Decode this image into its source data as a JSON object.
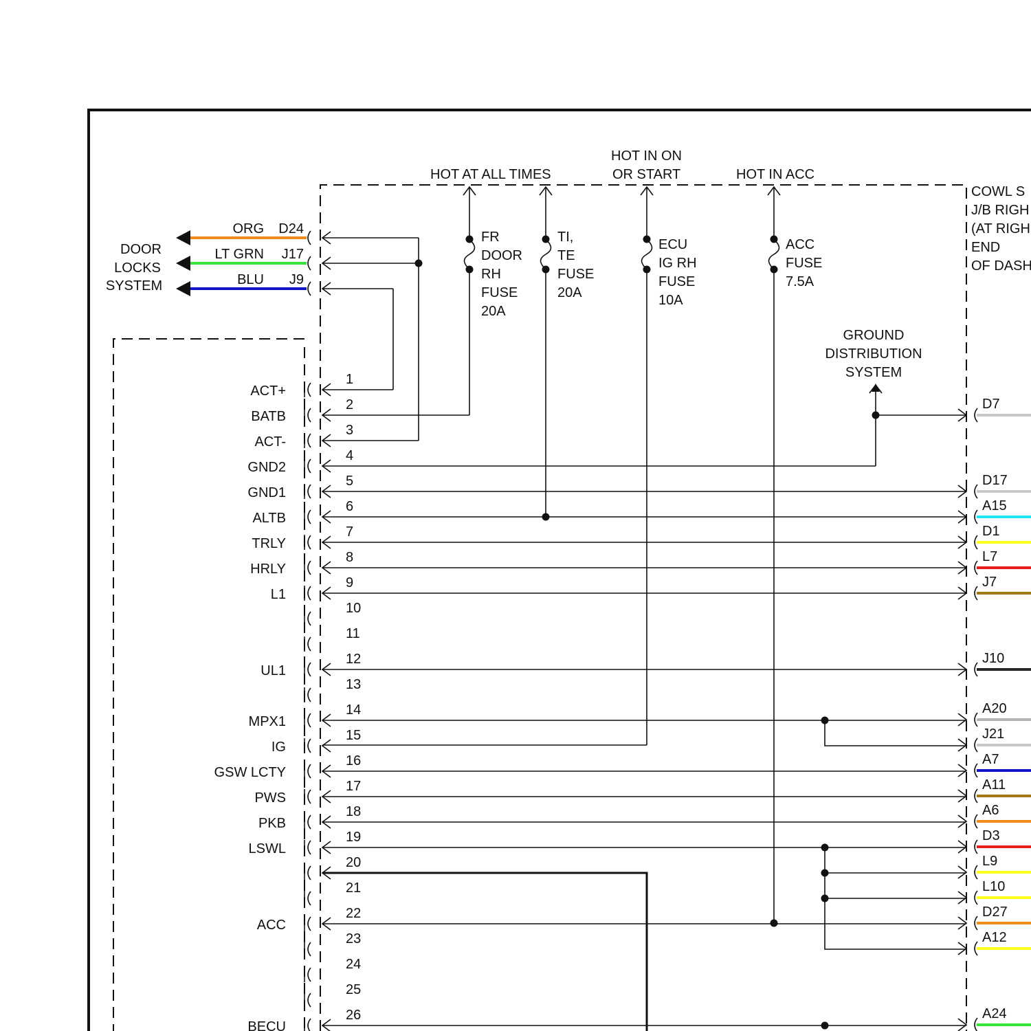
{
  "headers": {
    "hot_all_times": "HOT AT ALL TIMES",
    "hot_on_start_1": "HOT IN ON",
    "hot_on_start_2": "OR START",
    "hot_acc": "HOT IN ACC"
  },
  "fuses": [
    {
      "id": "fr-door",
      "lines": [
        "FR",
        "DOOR",
        "RH",
        "FUSE",
        "20A"
      ]
    },
    {
      "id": "ti-te",
      "lines": [
        "TI,",
        "TE",
        "FUSE",
        "20A"
      ]
    },
    {
      "id": "ecu-ig",
      "lines": [
        "ECU",
        "IG RH",
        "FUSE",
        "10A"
      ]
    },
    {
      "id": "acc",
      "lines": [
        "ACC",
        "FUSE",
        "7.5A"
      ]
    }
  ],
  "cowl_box": [
    "COWL S",
    "J/B RIGH",
    "(AT RIGH",
    "END",
    "OF DASH"
  ],
  "ground_system": [
    "GROUND",
    "DISTRIBUTION",
    "SYSTEM"
  ],
  "door_locks": {
    "label": [
      "DOOR",
      "LOCKS",
      "SYSTEM"
    ],
    "wires": [
      {
        "color_name": "ORG",
        "pin": "D24",
        "hex": "#f08a1c"
      },
      {
        "color_name": "LT GRN",
        "pin": "J17",
        "hex": "#39e23a"
      },
      {
        "color_name": "BLU",
        "pin": "J9",
        "hex": "#1414c8"
      }
    ]
  },
  "pins": [
    "1",
    "2",
    "3",
    "4",
    "5",
    "6",
    "7",
    "8",
    "9",
    "10",
    "11",
    "12",
    "13",
    "14",
    "15",
    "16",
    "17",
    "18",
    "19",
    "20",
    "21",
    "22",
    "23",
    "24",
    "25",
    "26"
  ],
  "signals": [
    {
      "pin": 1,
      "label": "ACT+"
    },
    {
      "pin": 2,
      "label": "BATB"
    },
    {
      "pin": 3,
      "label": "ACT-"
    },
    {
      "pin": 4,
      "label": "GND2"
    },
    {
      "pin": 5,
      "label": "GND1"
    },
    {
      "pin": 6,
      "label": "ALTB"
    },
    {
      "pin": 7,
      "label": "TRLY"
    },
    {
      "pin": 8,
      "label": "HRLY"
    },
    {
      "pin": 9,
      "label": "L1"
    },
    {
      "pin": 12,
      "label": "UL1"
    },
    {
      "pin": 14,
      "label": "MPX1"
    },
    {
      "pin": 15,
      "label": "IG"
    },
    {
      "pin": 16,
      "label": "GSW LCTY"
    },
    {
      "pin": 17,
      "label": "PWS"
    },
    {
      "pin": 18,
      "label": "PKB"
    },
    {
      "pin": 19,
      "label": "LSWL"
    },
    {
      "pin": 22,
      "label": "ACC"
    },
    {
      "pin": 26,
      "label": "BECU"
    }
  ],
  "right_connectors": [
    {
      "pin": "D7",
      "hex": "#c8c8c8"
    },
    {
      "pin": "D17",
      "hex": "#c8c8c8"
    },
    {
      "pin": "A15",
      "hex": "#1ee6f0"
    },
    {
      "pin": "D1",
      "hex": "#ffff1e"
    },
    {
      "pin": "L7",
      "hex": "#e61e1e"
    },
    {
      "pin": "J7",
      "hex": "#a07814"
    },
    {
      "pin": "J10",
      "hex": "#282828"
    },
    {
      "pin": "A20",
      "hex": "#b4b4b4"
    },
    {
      "pin": "J21",
      "hex": "#c8c8c8"
    },
    {
      "pin": "A7",
      "hex": "#1414c8"
    },
    {
      "pin": "A11",
      "hex": "#a07814"
    },
    {
      "pin": "A6",
      "hex": "#f08a1c"
    },
    {
      "pin": "D3",
      "hex": "#e61e1e"
    },
    {
      "pin": "L9",
      "hex": "#ffff1e"
    },
    {
      "pin": "L10",
      "hex": "#ffff1e"
    },
    {
      "pin": "D27",
      "hex": "#f08a1c"
    },
    {
      "pin": "A12",
      "hex": "#ffff1e"
    },
    {
      "pin": "A24",
      "hex": "#39e23a"
    }
  ]
}
